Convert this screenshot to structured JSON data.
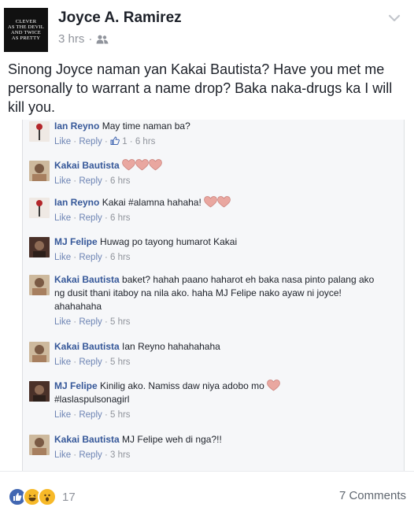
{
  "post": {
    "avatar_lines": [
      "CLEVER",
      "AS THE DEVIL",
      "AND TWICE",
      "AS PRETTY"
    ],
    "author": "Joyce A. Ramirez",
    "time": "3 hrs",
    "separator": "·",
    "audience_icon": "friends-icon",
    "text": "Sinong Joyce naman yan Kakai Bautista? Have you met me personally to warrant a name drop? Baka naka-drugs ka I will kill you."
  },
  "comments": [
    {
      "name": "Ian Reyno",
      "text": "May time naman ba?",
      "like": "Like",
      "reply": "Reply",
      "likes": "1",
      "time": "6 hrs",
      "avatar": "rose",
      "hearts": 0
    },
    {
      "name": "Kakai Bautista",
      "text": "",
      "like": "Like",
      "reply": "Reply",
      "likes": "",
      "time": "6 hrs",
      "avatar": "kakai",
      "hearts": 3
    },
    {
      "name": "Ian Reyno",
      "text": "Kakai #alamna hahaha!",
      "like": "Like",
      "reply": "Reply",
      "likes": "",
      "time": "6 hrs",
      "avatar": "rose",
      "hearts": 2
    },
    {
      "name": "MJ Felipe",
      "text": "Huwag po tayong humarot Kakai",
      "like": "Like",
      "reply": "Reply",
      "likes": "",
      "time": "6 hrs",
      "avatar": "mj",
      "hearts": 0
    },
    {
      "name": "Kakai Bautista",
      "text": "baket? hahah paano haharot eh baka nasa pinto palang ako ng dusit thani itaboy na nila ako. haha MJ Felipe nako ayaw ni joyce! ahahahaha",
      "like": "Like",
      "reply": "Reply",
      "likes": "",
      "time": "5 hrs",
      "avatar": "kakai",
      "hearts": 0
    },
    {
      "name": "Kakai Bautista",
      "text": "Ian Reyno hahahahaha",
      "like": "Like",
      "reply": "Reply",
      "likes": "",
      "time": "5 hrs",
      "avatar": "kakai",
      "hearts": 0
    },
    {
      "name": "MJ Felipe",
      "text": "Kinilig ako. Namiss daw niya adobo mo",
      "text2": "#laslaspulsonagirl",
      "like": "Like",
      "reply": "Reply",
      "likes": "",
      "time": "5 hrs",
      "avatar": "mj",
      "hearts": 1
    },
    {
      "name": "Kakai Bautista",
      "text": "MJ Felipe weh di nga?!!",
      "like": "Like",
      "reply": "Reply",
      "likes": "",
      "time": "3 hrs",
      "avatar": "kakai",
      "hearts": 0
    }
  ],
  "footer": {
    "reaction_icons": [
      "like-reaction-icon",
      "haha-reaction-icon",
      "wow-reaction-icon"
    ],
    "reaction_count": "17",
    "comments_label": "7 Comments"
  },
  "colors": {
    "name_blue": "#365899",
    "meta_gray": "#90949c",
    "like_blue": "#4267b2",
    "heart_pink": "#e9a7a0"
  }
}
